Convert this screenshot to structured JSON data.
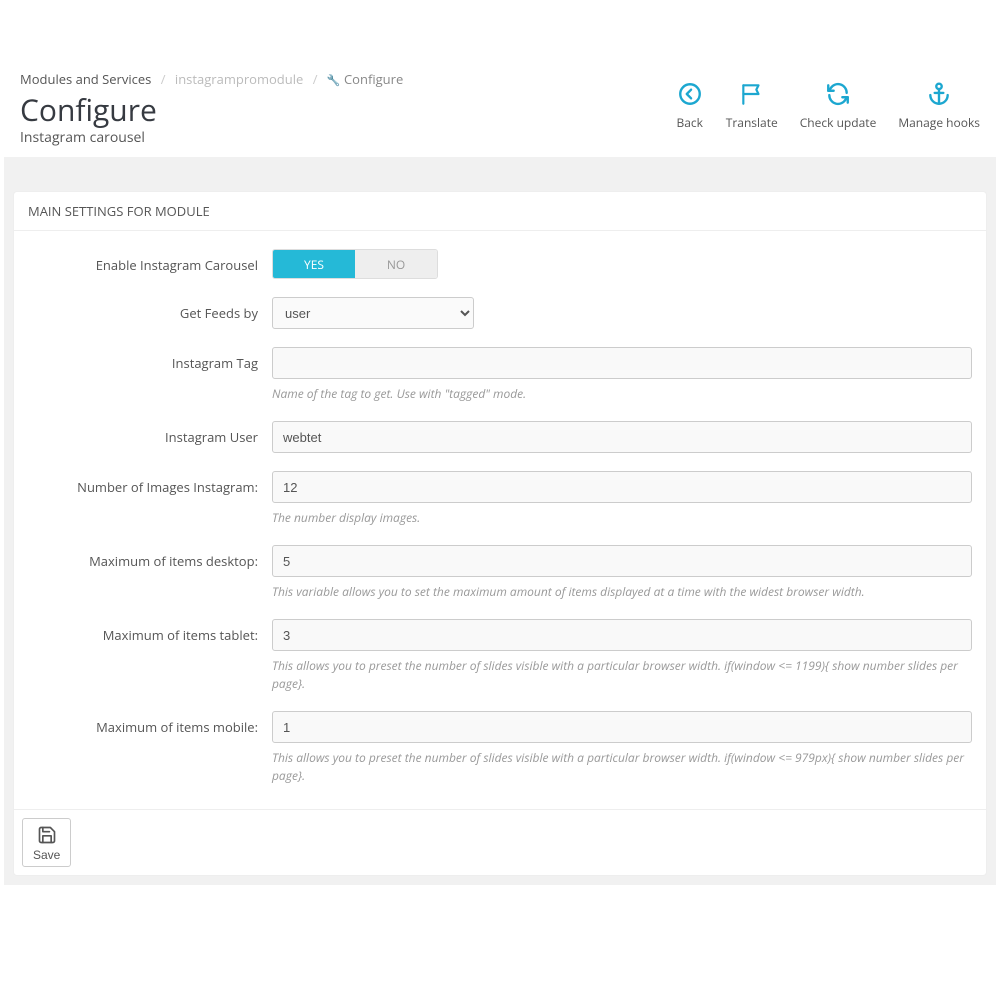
{
  "breadcrumb": {
    "root": "Modules and Services",
    "module": "instagrampromodule",
    "action": "Configure"
  },
  "page": {
    "title": "Configure",
    "subtitle": "Instagram carousel"
  },
  "toolbar": {
    "back": "Back",
    "translate": "Translate",
    "check_update": "Check update",
    "manage_hooks": "Manage hooks"
  },
  "panel": {
    "heading": "MAIN SETTINGS FOR MODULE"
  },
  "fields": {
    "enable": {
      "label": "Enable Instagram Carousel",
      "yes": "YES",
      "no": "NO"
    },
    "feeds_by": {
      "label": "Get Feeds by",
      "value": "user"
    },
    "tag": {
      "label": "Instagram Tag",
      "value": "",
      "help": "Name of the tag to get. Use with \"tagged\" mode."
    },
    "user": {
      "label": "Instagram User",
      "value": "webtet"
    },
    "num_images": {
      "label": "Number of Images Instagram:",
      "value": "12",
      "help": "The number display images."
    },
    "max_desktop": {
      "label": "Maximum of items desktop:",
      "value": "5",
      "help": "This variable allows you to set the maximum amount of items displayed at a time with the widest browser width."
    },
    "max_tablet": {
      "label": "Maximum of items tablet:",
      "value": "3",
      "help": "This allows you to preset the number of slides visible with a particular browser width. if(window <= 1199){ show number slides per page}."
    },
    "max_mobile": {
      "label": "Maximum of items mobile:",
      "value": "1",
      "help": "This allows you to preset the number of slides visible with a particular browser width. if(window <= 979px){ show number slides per page}."
    }
  },
  "footer": {
    "save": "Save"
  }
}
